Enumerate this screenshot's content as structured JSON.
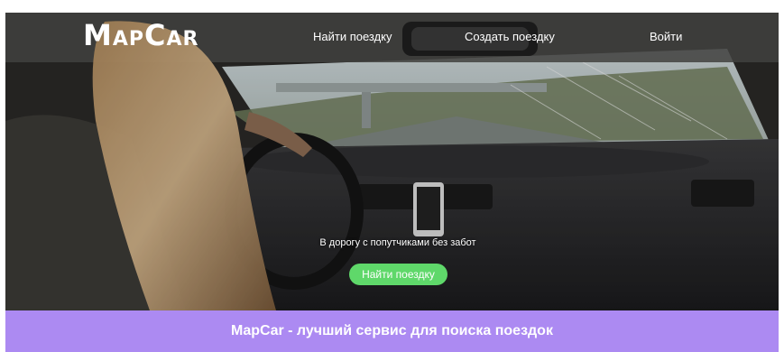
{
  "nav": {
    "logo": "MapCar",
    "find_trip": "Найти поездку",
    "create_trip": "Создать поездку",
    "login": "Войти"
  },
  "hero": {
    "tagline": "В дорогу с попутчиками без забот",
    "cta_label": "Найти поездку"
  },
  "banner": {
    "title": "MapCar - лучший сервис для поиска поездок"
  },
  "colors": {
    "cta": "#5fd86a",
    "banner": "#ac8af2"
  }
}
